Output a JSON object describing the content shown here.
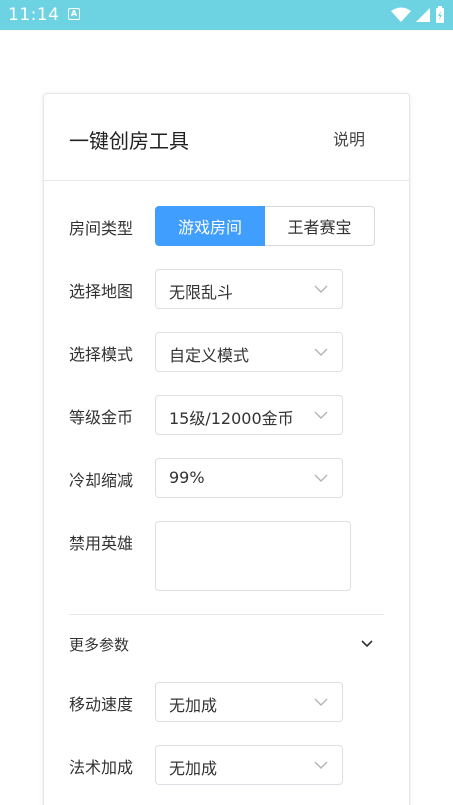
{
  "status_bar": {
    "time": "11:14",
    "app_icon_letter": "A"
  },
  "header": {
    "title": "一键创房工具",
    "help_label": "说明"
  },
  "room_type": {
    "label": "房间类型",
    "options": [
      "游戏房间",
      "王者赛宝"
    ],
    "selected": "游戏房间"
  },
  "fields": {
    "map": {
      "label": "选择地图",
      "value": "无限乱斗"
    },
    "mode": {
      "label": "选择模式",
      "value": "自定义模式"
    },
    "level_gold": {
      "label": "等级金币",
      "value": "15级/12000金币"
    },
    "cooldown": {
      "label": "冷却缩减",
      "value": "99%"
    },
    "banned_heroes": {
      "label": "禁用英雄",
      "value": ""
    },
    "move_speed": {
      "label": "移动速度",
      "value": "无加成"
    },
    "magic_bonus": {
      "label": "法术加成",
      "value": "无加成"
    }
  },
  "more_params": {
    "label": "更多参数"
  },
  "colors": {
    "status_bar": "#6dd3e3",
    "accent": "#409eff"
  }
}
